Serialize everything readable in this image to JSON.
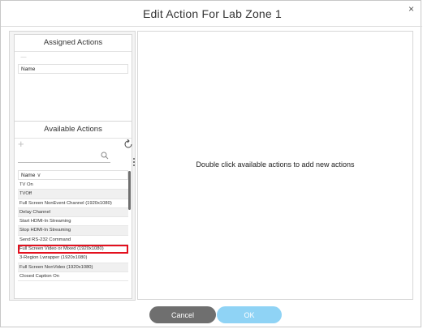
{
  "dialog": {
    "title": "Edit Action For Lab Zone 1",
    "close_glyph": "×"
  },
  "assigned": {
    "heading": "Assigned Actions",
    "toolbar_glyph": "—",
    "column_name": "Name"
  },
  "available": {
    "heading": "Available Actions",
    "add_glyph": "+",
    "search_placeholder": "",
    "column_name": "Name",
    "sort_glyph": "∨",
    "items": [
      "TV On",
      "TVOff",
      "Full Screen NonEvent Channel (1920x1080)",
      "Delay Channel",
      "Start HDMI-In Streaming",
      "Stop HDMI-In Streaming",
      "Send RS-232 Command",
      "Full Screen Video or Mixed (1920x1080)",
      "3-Region Lwrapper (1920x1080)",
      "Full Screen NonVideo (1920x1080)",
      "Closed Caption On"
    ],
    "selected_index": 7
  },
  "main": {
    "hint": "Double click available actions to add new actions"
  },
  "buttons": {
    "cancel": "Cancel",
    "ok": "OK"
  },
  "colors": {
    "selection_outline": "#e3101e",
    "ok_button": "#8fd3f5",
    "cancel_button": "#6f6f6f"
  }
}
